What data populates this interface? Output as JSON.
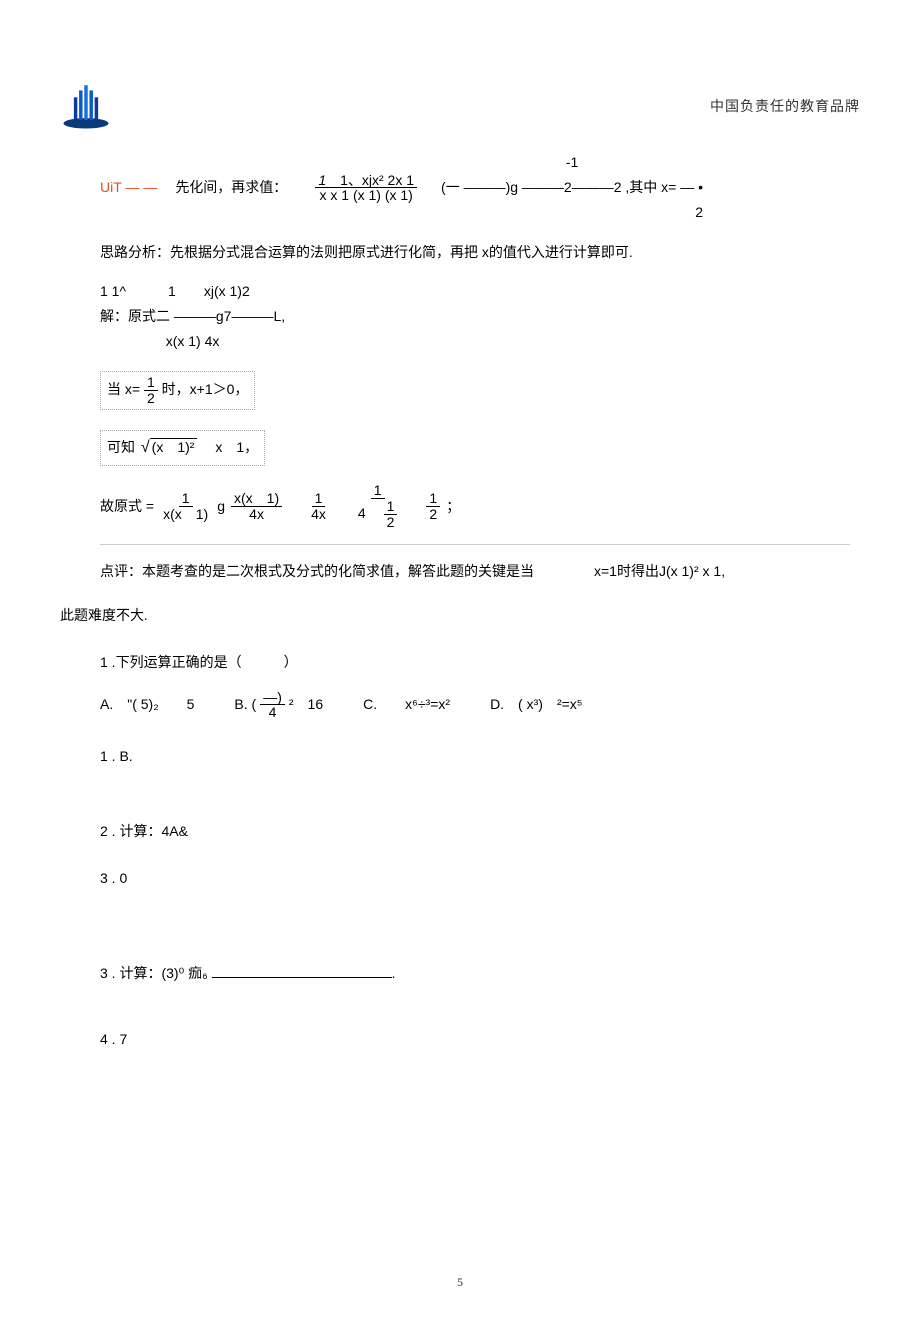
{
  "header": {
    "brand": "中国负责任的教育品牌"
  },
  "example": {
    "label": "UiT — —",
    "prompt": "先化间，再求值：",
    "expr_a": "1",
    "expr_b": "1、xjx² 2x 1",
    "expr_c": "-1",
    "expr_d": "(一 ———)g ———2———2 ,其中 x= — •",
    "expr_den": "x x 1 (x 1) (x 1)",
    "expr_e": "2"
  },
  "analysis": "思路分析：先根据分式混合运算的法则把原式进行化简，再把 x的值代入进行计算即可.",
  "solution": {
    "line1_a": "1 1^",
    "line1_b": "1",
    "line1_c": "xj(x 1)2",
    "line1_label": "解：原式二 ———g7———L,",
    "line1_den": "x(x 1) 4x",
    "step2_pre": "当 x=",
    "step2_frac_num": "1",
    "step2_frac_den": "2",
    "step2_post": "时，x+1＞0，",
    "step3_pre": "可知 ",
    "step3_rad": "(x　1)²",
    "step3_post": "　x　1，",
    "step4_pre": "故原式 = ",
    "step4_f1_num": "1",
    "step4_f1_den": "x(x　1)",
    "step4_g": "g",
    "step4_f2_num": "x(x　1)",
    "step4_f2_den": "4x",
    "step4_f3_num": "1",
    "step4_f3_den": "4x",
    "step4_f4_num": "1",
    "step4_f4_den_top": "4　",
    "step4_f4_den_f_num": "1",
    "step4_f4_den_f_den": "2",
    "step4_f5_num": "1",
    "step4_f5_den": "2",
    "step4_semi": "；"
  },
  "comment_a": "点评：本题考查的是二次根式及分式的化简求值，解答此题的关键是当",
  "comment_b": "x=1时得出J(x 1)² x 1,",
  "comment_c": "此题难度不大.",
  "q1": {
    "stem": "1 .下列运算正确的是（　　　）",
    "optA_pre": "A.　\"( 5)₂　　5",
    "optB_pre": "B. (",
    "optB_frac_num": "—)",
    "optB_frac_den": "4",
    "optB_post": "²　16",
    "optC": "C.　　x⁶÷³=x²",
    "optD": "D.　( x³)　²=x⁵",
    "ans": "1 . B."
  },
  "q2": {
    "stem": "2 . 计算：4A&",
    "ans": "3 . 0"
  },
  "q3": {
    "stem_pre": "3 . 计算：(3)⁰ 痂₆ ",
    "stem_post": ".",
    "ans": "4 . 7"
  },
  "pagenum": "5"
}
